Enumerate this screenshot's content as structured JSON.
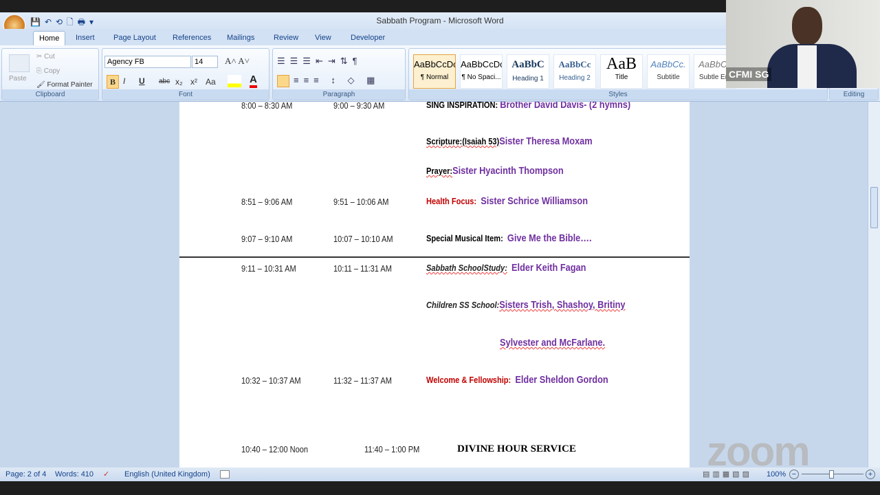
{
  "window": {
    "title": "Sabbath Program - Microsoft Word"
  },
  "tabs": [
    "Home",
    "Insert",
    "Page Layout",
    "References",
    "Mailings",
    "Review",
    "View",
    "Developer"
  ],
  "clipboard": {
    "paste": "Paste",
    "cut": "Cut",
    "copy": "Copy",
    "format_painter": "Format Painter",
    "label": "Clipboard"
  },
  "font": {
    "name": "Agency FB",
    "size": "14",
    "label": "Font",
    "bold": "B",
    "italic": "I",
    "underline": "U",
    "strike": "abc",
    "sub": "x₂",
    "sup": "x²",
    "case": "Aa"
  },
  "paragraph": {
    "label": "Paragraph"
  },
  "styles": {
    "label": "Styles",
    "items": [
      {
        "sample": "AaBbCcDc",
        "name": "¶ Normal"
      },
      {
        "sample": "AaBbCcDc",
        "name": "¶ No Spaci..."
      },
      {
        "sample": "AaBbC",
        "name": "Heading 1"
      },
      {
        "sample": "AaBbCc",
        "name": "Heading 2"
      },
      {
        "sample": "AaB",
        "name": "Title"
      },
      {
        "sample": "AaBbCc.",
        "name": "Subtitle"
      },
      {
        "sample": "AaBbCc",
        "name": "Subtle Em"
      }
    ]
  },
  "editing": {
    "label": "Editing"
  },
  "document": {
    "rows": [
      {
        "t1": "8:00 – 8:30 AM",
        "t2": "9:00 – 9:30 AM",
        "label": "SING INSPIRATION:",
        "name": "Brother David Davis- (2 hymns)"
      },
      {
        "label": "Scripture:(Isaiah 53)",
        "name": "Sister Theresa Moxam"
      },
      {
        "label": "Prayer:",
        "name": "Sister Hyacinth Thompson"
      },
      {
        "t1": "8:51 – 9:06 AM",
        "t2": "9:51 – 10:06 AM",
        "label": "Health Focus:",
        "name": "Sister Schrice Williamson"
      },
      {
        "t1": "9:07 – 9:10 AM",
        "t2": "10:07 – 10:10 AM",
        "label": "Special Musical Item:",
        "name": "Give Me the Bible…."
      },
      {
        "t1": "9:11 – 10:31 AM",
        "t2": "10:11 – 11:31 AM",
        "label": "Sabbath SchoolStudy:",
        "name": "Elder Keith Fagan"
      },
      {
        "label": "Children SS School:",
        "name": "Sisters Trish, Shashoy, Britiny"
      },
      {
        "name": "Sylvester and McFarlane."
      },
      {
        "t1": "10:32 – 10:37 AM",
        "t2": "11:32 – 11:37 AM",
        "label": "Welcome & Fellowship:",
        "name": "Elder Sheldon Gordon"
      },
      {
        "t1": "10:40 – 12:00 Noon",
        "t2": "11:40 – 1:00 PM",
        "label": "DIVINE HOUR SERVICE"
      }
    ]
  },
  "status": {
    "page": "Page: 2 of 4",
    "words": "Words: 410",
    "language": "English (United Kingdom)",
    "zoom": "100%"
  },
  "video": {
    "participant": "CFMI SG",
    "logo": "zoom"
  }
}
